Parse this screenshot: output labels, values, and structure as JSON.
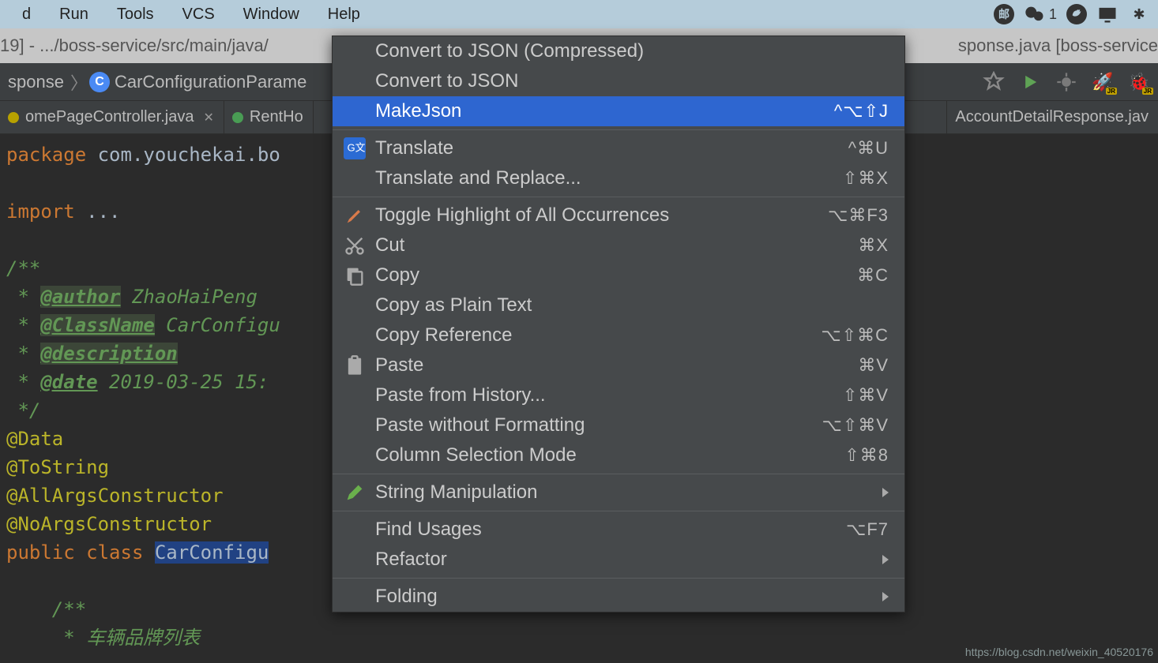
{
  "menubar": {
    "items": [
      "d",
      "Run",
      "Tools",
      "VCS",
      "Window",
      "Help"
    ],
    "tray_badge": "1"
  },
  "titlebar": {
    "left": "19] - .../boss-service/src/main/java/",
    "right": "sponse.java [boss-service"
  },
  "breadcrumb": {
    "first": "sponse",
    "class_label": "CarConfigurationParame"
  },
  "tabs": {
    "left": "omePageController.java",
    "middle": "RentHo",
    "right": "AccountDetailResponse.jav"
  },
  "code": {
    "l1_kw": "package",
    "l1_rest": " com.youchekai.bo",
    "l2_kw": "import",
    "l2_rest": " ...",
    "doc_open": "/**",
    "doc_author_tag": "@author",
    "doc_author_val": " ZhaoHaiPeng",
    "doc_class_tag": "@ClassName",
    "doc_class_val": " CarConfigu",
    "doc_desc_tag": "@description",
    "doc_date_tag": "@date",
    "doc_date_val": " 2019-03-25 15:",
    "doc_close": " */",
    "ann1": "@Data",
    "ann2": "@ToString",
    "ann3": "@AllArgsConstructor",
    "ann4": "@NoArgsConstructor",
    "cls_kw1": "public",
    "cls_kw2": "class",
    "cls_name": "CarConfigu",
    "inner_doc_open": "/**",
    "inner_doc_line": " * 车辆品牌列表"
  },
  "menu": [
    {
      "type": "item",
      "label": "Convert to JSON (Compressed)",
      "shortcut": ""
    },
    {
      "type": "item",
      "label": "Convert to JSON",
      "shortcut": ""
    },
    {
      "type": "item",
      "label": "MakeJson",
      "shortcut": "^⌥⇧J",
      "selected": true
    },
    {
      "type": "sep"
    },
    {
      "type": "item",
      "label": "Translate",
      "shortcut": "^⌘U",
      "icon": "translate"
    },
    {
      "type": "item",
      "label": "Translate and Replace...",
      "shortcut": "⇧⌘X"
    },
    {
      "type": "sep"
    },
    {
      "type": "item",
      "label": "Toggle Highlight of All Occurrences",
      "shortcut": "⌥⌘F3",
      "icon": "highlighter"
    },
    {
      "type": "item",
      "label": "Cut",
      "shortcut": "⌘X",
      "icon": "cut"
    },
    {
      "type": "item",
      "label": "Copy",
      "shortcut": "⌘C",
      "icon": "copy"
    },
    {
      "type": "item",
      "label": "Copy as Plain Text",
      "shortcut": ""
    },
    {
      "type": "item",
      "label": "Copy Reference",
      "shortcut": "⌥⇧⌘C"
    },
    {
      "type": "item",
      "label": "Paste",
      "shortcut": "⌘V",
      "icon": "paste"
    },
    {
      "type": "item",
      "label": "Paste from History...",
      "shortcut": "⇧⌘V"
    },
    {
      "type": "item",
      "label": "Paste without Formatting",
      "shortcut": "⌥⇧⌘V"
    },
    {
      "type": "item",
      "label": "Column Selection Mode",
      "shortcut": "⇧⌘8"
    },
    {
      "type": "sep"
    },
    {
      "type": "item",
      "label": "String Manipulation",
      "submenu": true,
      "icon": "pencil"
    },
    {
      "type": "sep"
    },
    {
      "type": "item",
      "label": "Find Usages",
      "shortcut": "⌥F7"
    },
    {
      "type": "item",
      "label": "Refactor",
      "submenu": true
    },
    {
      "type": "sep"
    },
    {
      "type": "item",
      "label": "Folding",
      "submenu": true
    }
  ],
  "watermark": "https://blog.csdn.net/weixin_40520176"
}
